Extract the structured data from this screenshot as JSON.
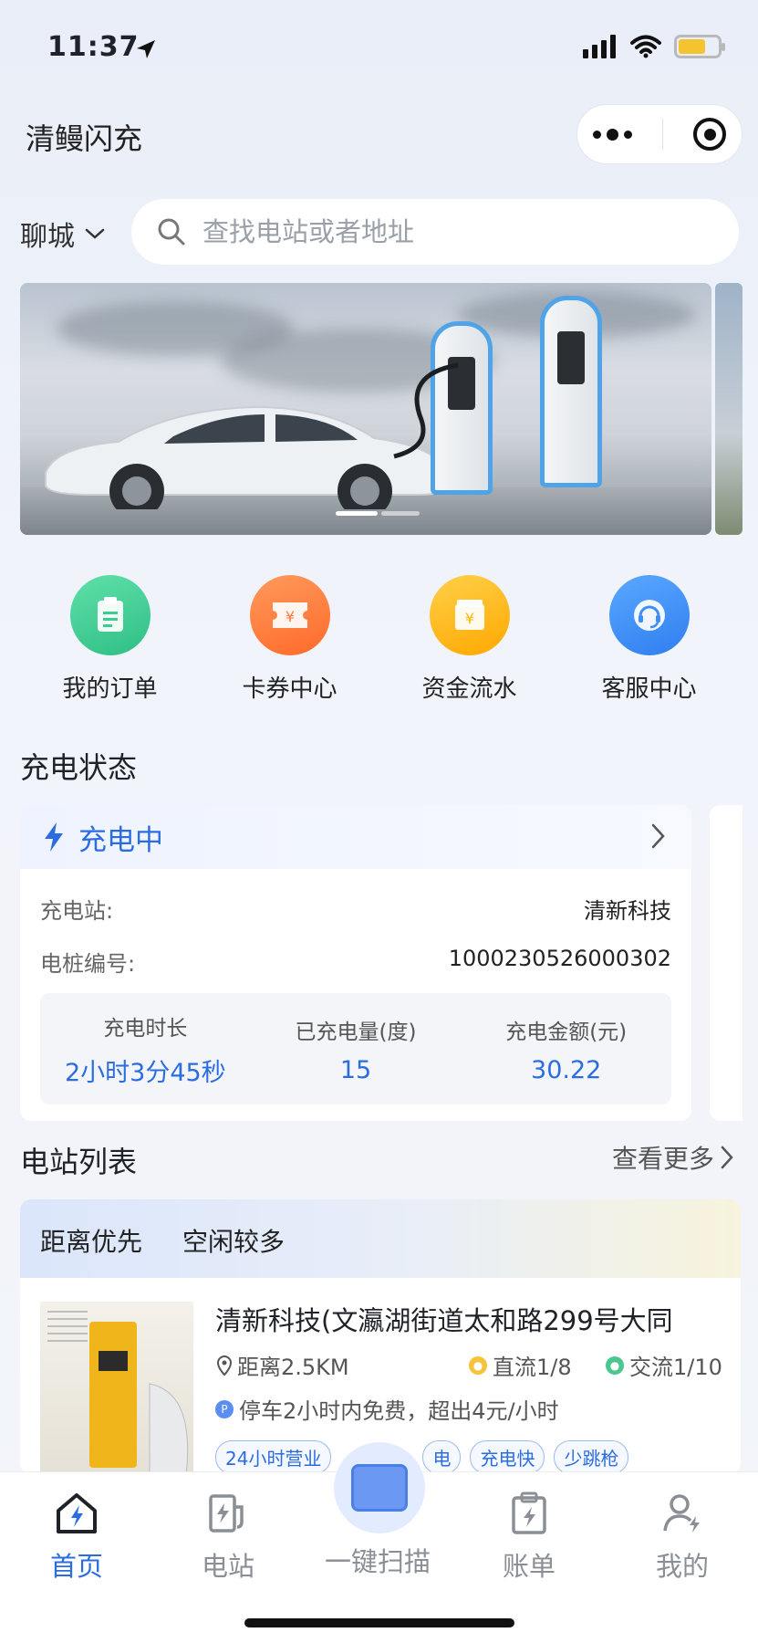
{
  "status_bar": {
    "time": "11:37"
  },
  "header": {
    "app_title": "清鳗闪充"
  },
  "search": {
    "city": "聊城",
    "placeholder": "查找电站或者地址"
  },
  "banner": {
    "active_index": 0,
    "count": 2
  },
  "quick_menu": [
    {
      "label": "我的订单",
      "icon": "clipboard-icon",
      "color": "#3ecb8f"
    },
    {
      "label": "卡券中心",
      "icon": "ticket-icon",
      "color": "#ff7a3d"
    },
    {
      "label": "资金流水",
      "icon": "wallet-icon",
      "color": "#ffb400"
    },
    {
      "label": "客服中心",
      "icon": "headset-icon",
      "color": "#3f8ef5"
    }
  ],
  "charging_status": {
    "section_title": "充电状态",
    "state": "充电中",
    "station_label": "充电站:",
    "station_value": "清新科技",
    "pile_label": "电桩编号:",
    "pile_value": "1000230526000302",
    "stats": [
      {
        "label": "充电时长",
        "value": "2小时3分45秒"
      },
      {
        "label": "已充电量(度)",
        "value": "15"
      },
      {
        "label": "充电金额(元)",
        "value": "30.22"
      }
    ]
  },
  "station_list": {
    "section_title": "电站列表",
    "more_label": "查看更多",
    "tabs": [
      "距离优先",
      "空闲较多"
    ],
    "stations": [
      {
        "name": "清新科技(文瀛湖街道太和路299号大同",
        "distance": "距离2.5KM",
        "dc": "直流1/8",
        "ac": "交流1/10",
        "parking": "停车2小时内免费，超出4元/小时",
        "tags": [
          "24小时营业",
          "电",
          "充电快",
          "少跳枪"
        ]
      }
    ]
  },
  "tabbar": {
    "items": [
      {
        "label": "首页",
        "active": true
      },
      {
        "label": "电站",
        "active": false
      },
      {
        "label": "一键扫描",
        "active": false
      },
      {
        "label": "账单",
        "active": false
      },
      {
        "label": "我的",
        "active": false
      }
    ]
  },
  "colors": {
    "accent": "#2b6de0",
    "text": "#1f2329",
    "muted": "#8a8f96"
  }
}
